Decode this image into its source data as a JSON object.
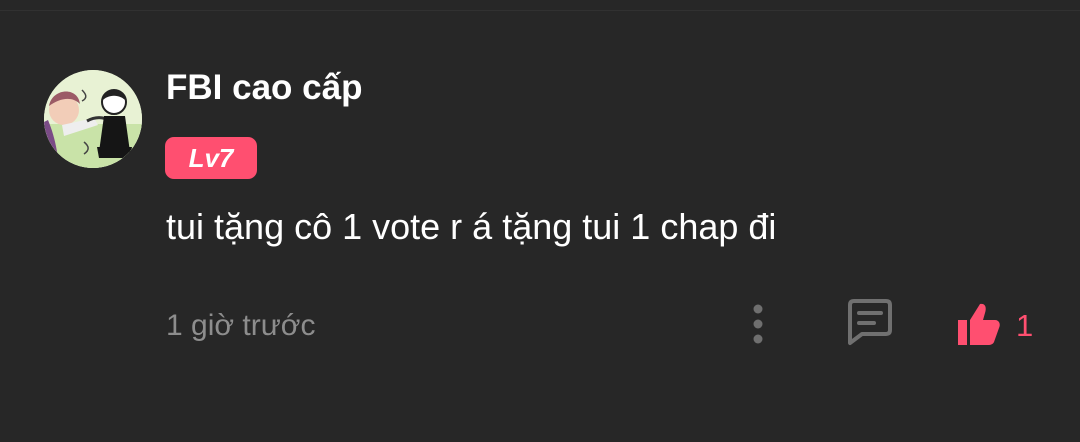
{
  "comment": {
    "username": "FBI cao cấp",
    "level": "Lv7",
    "text": "tui tặng cô 1 vote r á tặng tui 1 chap đi",
    "timestamp": "1 giờ trước",
    "like_count": "1"
  },
  "icons": {
    "more": "more-vertical-icon",
    "reply": "comment-icon",
    "like": "thumbs-up-icon"
  },
  "colors": {
    "background": "#272727",
    "accent": "#ff4f70",
    "muted": "#8d8d8d",
    "text": "#ffffff"
  }
}
